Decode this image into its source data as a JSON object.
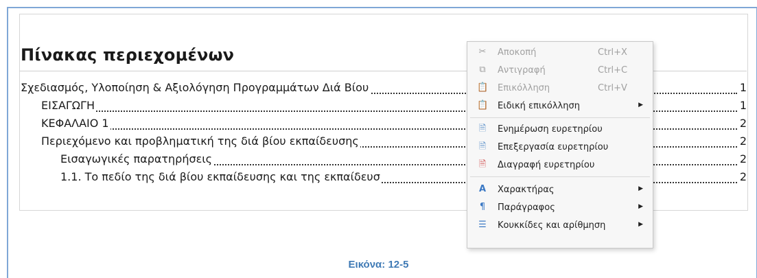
{
  "toc": {
    "title": "Πίνακας περιεχομένων",
    "entries": [
      {
        "text": "Σχεδιασμός, Υλοποίηση & Αξιολόγηση Προγραμμάτων Διά Βίου",
        "page": "1"
      },
      {
        "text": "ΕΙΣΑΓΩΓΗ",
        "page": "1"
      },
      {
        "text": "ΚΕΦΑΛΑΙΟ 1",
        "page": "2"
      },
      {
        "text": "Περιεχόμενο και προβληματική της διά βίου εκπαίδευσης",
        "page": "2"
      },
      {
        "text": "Εισαγωγικές παρατηρήσεις",
        "page": "2"
      },
      {
        "text": "1.1. Το πεδίο της διά βίου εκπαίδευσης και της εκπαίδευσ",
        "page": "2"
      }
    ]
  },
  "context_menu": {
    "items": [
      {
        "label": "Αποκοπή",
        "shortcut": "Ctrl+X",
        "icon": "scissors-icon",
        "glyph": "✂",
        "disabled": true,
        "submenu": false
      },
      {
        "label": "Αντιγραφή",
        "shortcut": "Ctrl+C",
        "icon": "copy-icon",
        "glyph": "⧉",
        "disabled": true,
        "submenu": false
      },
      {
        "label": "Επικόλληση",
        "shortcut": "Ctrl+V",
        "icon": "paste-icon",
        "glyph": "📋",
        "disabled": true,
        "submenu": false
      },
      {
        "label": "Ειδική επικόλληση",
        "shortcut": "",
        "icon": "paste-special-icon",
        "glyph": "📋",
        "disabled": false,
        "submenu": true
      },
      {
        "label": "Ενημέρωση ευρετηρίου",
        "shortcut": "",
        "icon": "update-index-icon",
        "glyph": "🗎",
        "disabled": false,
        "submenu": false
      },
      {
        "label": "Επεξεργασία ευρετηρίου",
        "shortcut": "",
        "icon": "edit-index-icon",
        "glyph": "🗎",
        "disabled": false,
        "submenu": false
      },
      {
        "label": "Διαγραφή ευρετηρίου",
        "shortcut": "",
        "icon": "delete-index-icon",
        "glyph": "🗎",
        "disabled": false,
        "submenu": false
      },
      {
        "label": "Χαρακτήρας",
        "shortcut": "",
        "icon": "character-icon",
        "glyph": "A",
        "disabled": false,
        "submenu": true
      },
      {
        "label": "Παράγραφος",
        "shortcut": "",
        "icon": "paragraph-icon",
        "glyph": "¶",
        "disabled": false,
        "submenu": true
      },
      {
        "label": "Κουκκίδες και αρίθμηση",
        "shortcut": "",
        "icon": "bullets-numbering-icon",
        "glyph": "☰",
        "disabled": false,
        "submenu": true
      }
    ]
  },
  "caption": "Εικόνα: 12-5",
  "colors": {
    "caption": "#3f7ab5",
    "frame": "#7fa7d6",
    "menu_bg": "#f7f7f7",
    "disabled_text": "#a0a0a0"
  }
}
